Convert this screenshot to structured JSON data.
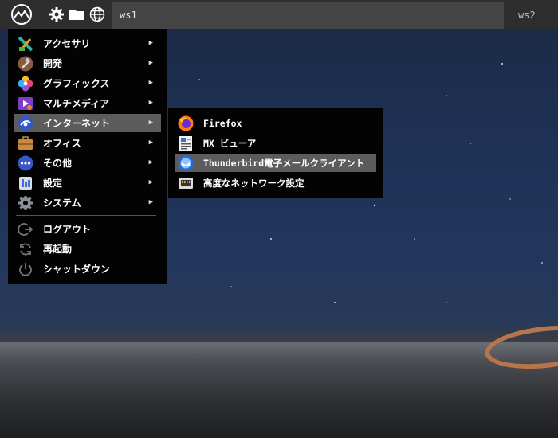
{
  "topbar": {
    "workspaces": [
      "ws1",
      "ws2"
    ]
  },
  "main_menu": {
    "categories": [
      {
        "label": "アクセサリ",
        "icon": "accessories-icon"
      },
      {
        "label": "開発",
        "icon": "development-icon"
      },
      {
        "label": "グラフィックス",
        "icon": "graphics-icon"
      },
      {
        "label": "マルチメディア",
        "icon": "multimedia-icon"
      },
      {
        "label": "インターネット",
        "icon": "internet-icon"
      },
      {
        "label": "オフィス",
        "icon": "office-icon"
      },
      {
        "label": "その他",
        "icon": "other-icon"
      },
      {
        "label": "設定",
        "icon": "settings-icon"
      },
      {
        "label": "システム",
        "icon": "system-icon"
      }
    ],
    "actions": [
      {
        "label": "ログアウト",
        "icon": "logout-icon"
      },
      {
        "label": "再起動",
        "icon": "reboot-icon"
      },
      {
        "label": "シャットダウン",
        "icon": "power-icon"
      }
    ],
    "selected": "インターネット"
  },
  "internet_submenu": {
    "items": [
      {
        "label": "Firefox",
        "icon": "firefox-icon"
      },
      {
        "label": "MX ビューア",
        "icon": "mx-viewer-icon"
      },
      {
        "label": "Thunderbird電子メールクライアント",
        "icon": "thunderbird-icon"
      },
      {
        "label": "高度なネットワーク設定",
        "icon": "network-settings-icon"
      }
    ],
    "selected": "Thunderbird電子メールクライアント"
  },
  "colors": {
    "topbar": "#2e2e2e",
    "active_workspace": "#444444",
    "menu_background": "#030303",
    "highlight": "#5c5c5c"
  }
}
